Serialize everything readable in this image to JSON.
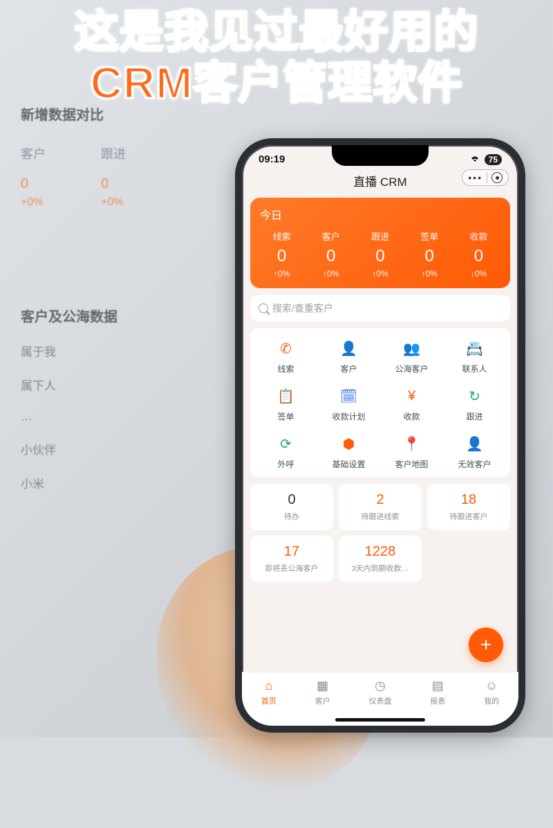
{
  "headline": "这是我见过最好用的\nCRM客户管理软件",
  "background": {
    "section1_title": "新增数据对比",
    "metrics": [
      {
        "label": "客户",
        "value": "0",
        "pct": "+0%"
      },
      {
        "label": "跟进",
        "value": "0",
        "pct": "+0%"
      }
    ],
    "section2_title": "客户及公海数据",
    "list": [
      "属于我",
      "属下人",
      "…",
      "小伙伴",
      "小米"
    ]
  },
  "status": {
    "time": "09:19",
    "battery": "75"
  },
  "app": {
    "title": "直播 CRM"
  },
  "dashboard": {
    "title": "今日",
    "cols": [
      {
        "label": "线索",
        "value": "0",
        "pct": "↑0%"
      },
      {
        "label": "客户",
        "value": "0",
        "pct": "↑0%"
      },
      {
        "label": "跟进",
        "value": "0",
        "pct": "↑0%"
      },
      {
        "label": "签单",
        "value": "0",
        "pct": "↑0%"
      },
      {
        "label": "收款",
        "value": "0",
        "pct": "↓0%"
      }
    ]
  },
  "search": {
    "placeholder": "搜索/查重客户"
  },
  "grid": [
    {
      "name": "grid-leads",
      "label": "线索",
      "color": "#ff5a05",
      "glyph": "✆"
    },
    {
      "name": "grid-customers",
      "label": "客户",
      "color": "#ff5a05",
      "glyph": "👤"
    },
    {
      "name": "grid-public-customers",
      "label": "公海客户",
      "color": "#2c6bed",
      "glyph": "👥"
    },
    {
      "name": "grid-contacts",
      "label": "联系人",
      "color": "#2c6bed",
      "glyph": "📇"
    },
    {
      "name": "grid-sign",
      "label": "签单",
      "color": "#ff5a05",
      "glyph": "📋"
    },
    {
      "name": "grid-payment-plan",
      "label": "收款计划",
      "color": "#2c6bed",
      "glyph": "🗓"
    },
    {
      "name": "grid-payment",
      "label": "收款",
      "color": "#ff5a05",
      "glyph": "¥"
    },
    {
      "name": "grid-followup",
      "label": "跟进",
      "color": "#2aa57c",
      "glyph": "↻"
    },
    {
      "name": "grid-outbound",
      "label": "外呼",
      "color": "#2aa57c",
      "glyph": "⟳"
    },
    {
      "name": "grid-settings",
      "label": "基础设置",
      "color": "#ff5a05",
      "glyph": "⬢"
    },
    {
      "name": "grid-map",
      "label": "客户地图",
      "color": "#ff5a05",
      "glyph": "📍"
    },
    {
      "name": "grid-invalid",
      "label": "无效客户",
      "color": "#9aa0a6",
      "glyph": "👤"
    }
  ],
  "tiles": [
    {
      "num": "0",
      "label": "待办",
      "accent": false
    },
    {
      "num": "2",
      "label": "待跟进线索",
      "accent": true
    },
    {
      "num": "18",
      "label": "待跟进客户",
      "accent": true
    },
    {
      "num": "17",
      "label": "即将丢公海客户",
      "accent": true
    },
    {
      "num": "1228",
      "label": "3天内到期收款…",
      "accent": true
    }
  ],
  "tabs": [
    {
      "name": "tab-home",
      "label": "首页",
      "glyph": "⌂",
      "active": true
    },
    {
      "name": "tab-customers",
      "label": "客户",
      "glyph": "▦",
      "active": false
    },
    {
      "name": "tab-dashboard",
      "label": "仪表盘",
      "glyph": "◷",
      "active": false
    },
    {
      "name": "tab-reports",
      "label": "报表",
      "glyph": "▤",
      "active": false
    },
    {
      "name": "tab-mine",
      "label": "我的",
      "glyph": "☺",
      "active": false
    }
  ],
  "fab": {
    "label": "+"
  }
}
